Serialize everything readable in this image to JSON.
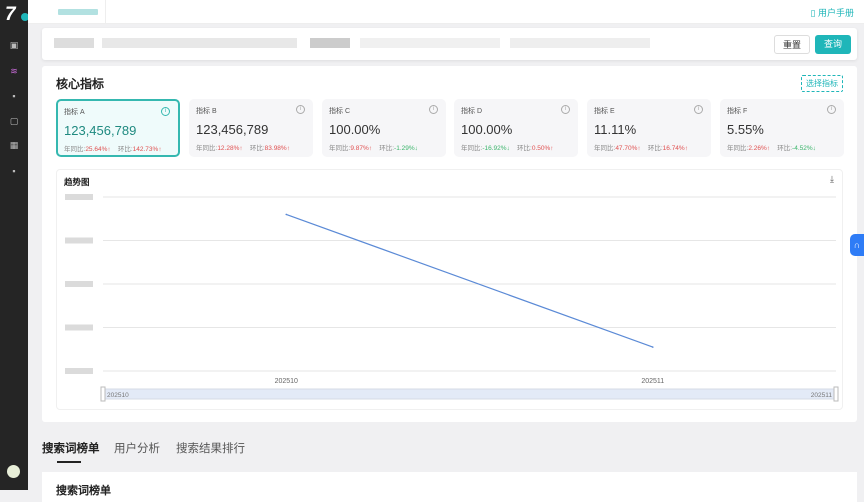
{
  "header": {
    "manual_label": "用户手册"
  },
  "filter": {
    "reset_label": "重置",
    "query_label": "查询"
  },
  "core": {
    "title": "核心指标",
    "choose_label": "选择指标",
    "cards": [
      {
        "name": "指标 A",
        "value": "123,456,789",
        "yoy_label": "年同比:",
        "yoy": "25.64%↑",
        "yoy_dir": "up",
        "mom_label": "环比:",
        "mom": "142.73%↑",
        "mom_dir": "up"
      },
      {
        "name": "指标 B",
        "value": "123,456,789",
        "yoy_label": "年同比:",
        "yoy": "12.28%↑",
        "yoy_dir": "up",
        "mom_label": "环比:",
        "mom": "83.98%↑",
        "mom_dir": "up"
      },
      {
        "name": "指标 C",
        "value": "100.00%",
        "yoy_label": "年同比:",
        "yoy": "9.87%↑",
        "yoy_dir": "up",
        "mom_label": "环比:",
        "mom": "-1.29%↓",
        "mom_dir": "down"
      },
      {
        "name": "指标 D",
        "value": "100.00%",
        "yoy_label": "年同比:",
        "yoy": "-16.92%↓",
        "yoy_dir": "down",
        "mom_label": "环比:",
        "mom": "0.50%↑",
        "mom_dir": "up"
      },
      {
        "name": "指标 E",
        "value": "11.11%",
        "yoy_label": "年同比:",
        "yoy": "47.70%↑",
        "yoy_dir": "up",
        "mom_label": "环比:",
        "mom": "16.74%↑",
        "mom_dir": "up"
      },
      {
        "name": "指标 F",
        "value": "5.55%",
        "yoy_label": "年同比:",
        "yoy": "2.26%↑",
        "yoy_dir": "up",
        "mom_label": "环比:",
        "mom": "-4.52%↓",
        "mom_dir": "down"
      }
    ]
  },
  "chart_data": {
    "type": "line",
    "title": "趋势图",
    "categories": [
      "202510",
      "202511"
    ],
    "values": [
      3.6,
      0.55
    ],
    "ylim": [
      0,
      4
    ],
    "grid": true,
    "color": "#5b8ad6",
    "zoom_slider": {
      "start_label": "202510",
      "end_label": "202511"
    }
  },
  "tabs": [
    {
      "label": "搜索词榜单",
      "active": true
    },
    {
      "label": "用户分析",
      "active": false
    },
    {
      "label": "搜索结果排行",
      "active": false
    }
  ],
  "section": {
    "title": "搜索词榜单"
  },
  "colors": {
    "accent": "#1fb6b9",
    "up": "#e05050",
    "down": "#3bb56b",
    "line": "#5b8ad6"
  }
}
